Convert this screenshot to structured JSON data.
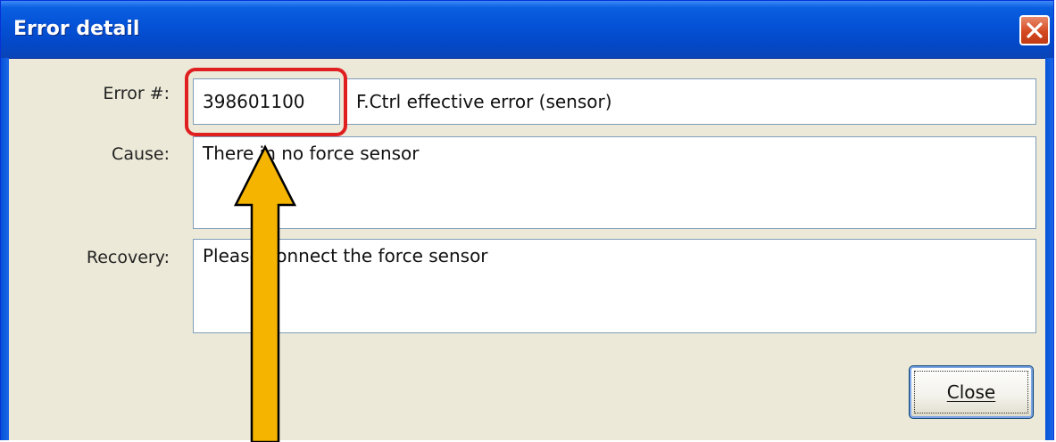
{
  "window": {
    "title": "Error detail"
  },
  "fields": {
    "error_label": "Error #:",
    "error_number": "398601100",
    "error_title": "F.Ctrl effective error (sensor)",
    "cause_label": "Cause:",
    "cause_text": "There in no force sensor",
    "recovery_label": "Recovery:",
    "recovery_text": "Please connect the force sensor"
  },
  "buttons": {
    "close_label": "Close"
  },
  "colors": {
    "titlebar": "#0553d8",
    "highlight": "#e02020",
    "arrow": "#f5b400",
    "face": "#ece9d8"
  },
  "icons": {
    "title_close": "close-icon",
    "annotation": "up-arrow-icon"
  }
}
